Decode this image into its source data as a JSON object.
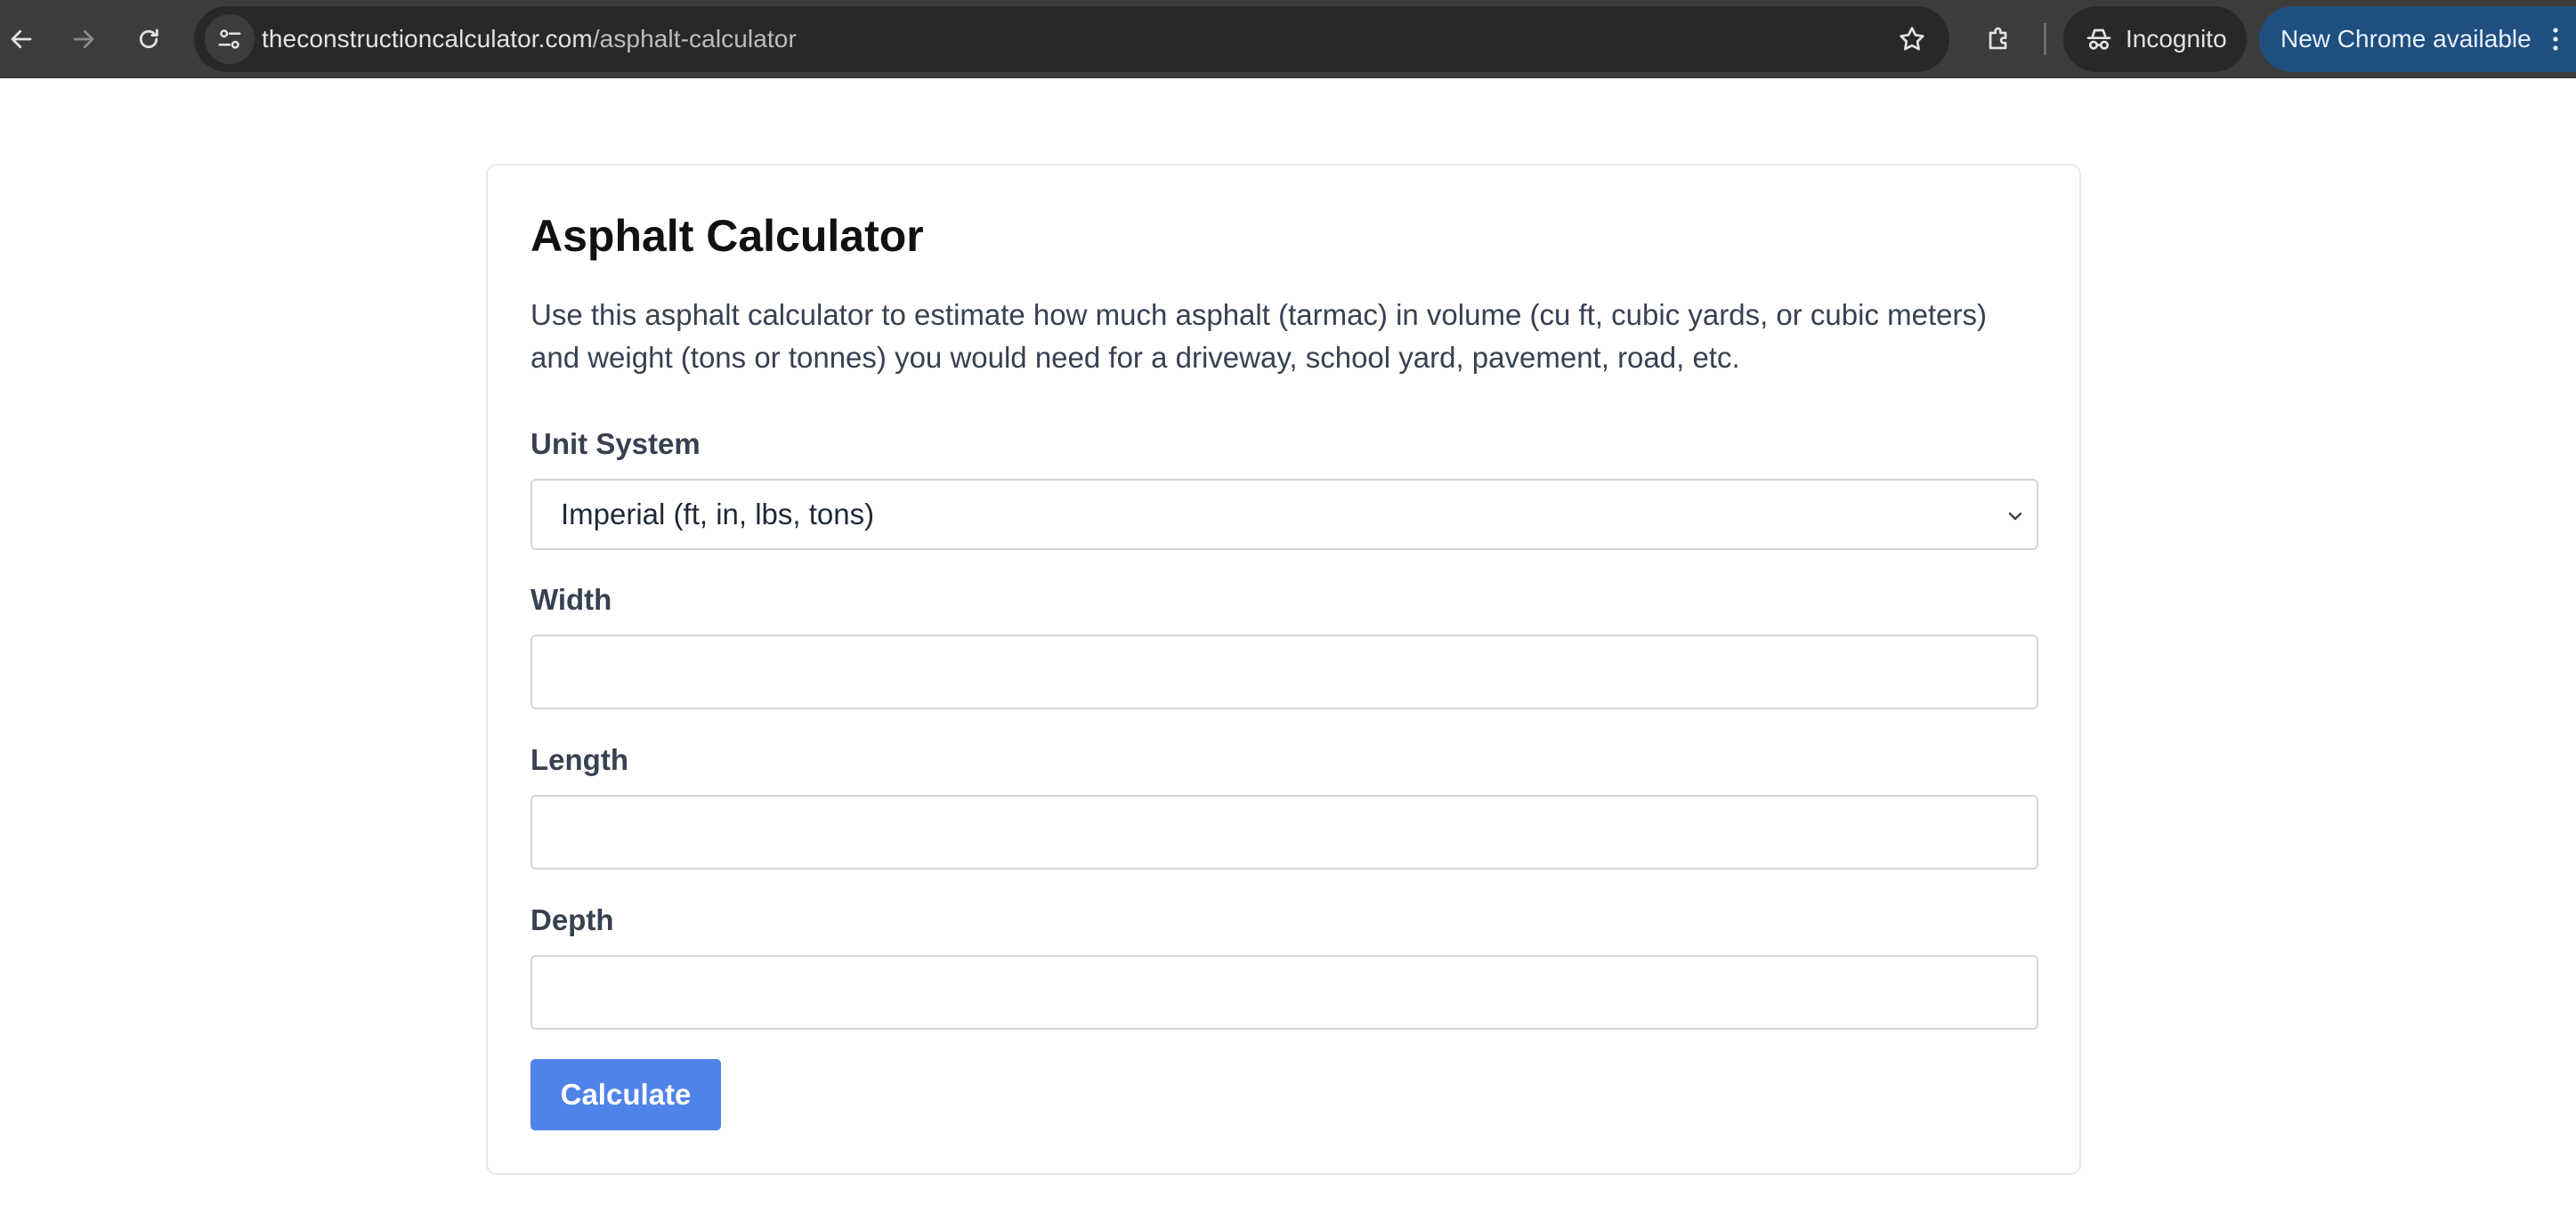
{
  "browser": {
    "url_domain": "theconstructioncalculator.com",
    "url_path": "/asphalt-calculator",
    "incognito_label": "Incognito",
    "update_label": "New Chrome available",
    "icons": {
      "back": "back-arrow-icon",
      "forward": "forward-arrow-icon",
      "reload": "reload-icon",
      "site_info": "tune-icon",
      "bookmark": "star-icon",
      "extensions": "puzzle-icon",
      "incognito": "incognito-icon",
      "menu": "kebab-menu-icon"
    },
    "colors": {
      "toolbar": "#3c3c3c",
      "omnibox": "#282828",
      "update_pill": "#1f4f7e"
    }
  },
  "calculator": {
    "title": "Asphalt Calculator",
    "description": "Use this asphalt calculator to estimate how much asphalt (tarmac) in volume (cu ft, cubic yards, or cubic meters) and weight (tons or tonnes) you would need for a driveway, school yard, pavement, road, etc.",
    "unit_system": {
      "label": "Unit System",
      "selected": "Imperial (ft, in, lbs, tons)"
    },
    "width": {
      "label": "Width",
      "value": ""
    },
    "length": {
      "label": "Length",
      "value": ""
    },
    "depth": {
      "label": "Depth",
      "value": ""
    },
    "calculate_label": "Calculate",
    "colors": {
      "button": "#4f83ea",
      "border": "#d1d5db"
    }
  }
}
